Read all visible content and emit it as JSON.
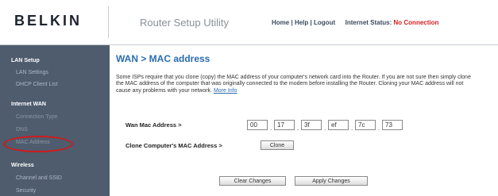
{
  "header": {
    "logo": "BELKIN",
    "title": "Router Setup Utility",
    "links": {
      "home": "Home",
      "sep1": "|",
      "help": "Help",
      "sep2": "|",
      "logout": "Logout"
    },
    "status_label": "Internet Status:",
    "status_value": "No Connection"
  },
  "sidebar": {
    "lan_setup": "LAN Setup",
    "lan_settings": "LAN Settings",
    "dhcp_client_list": "DHCP Client List",
    "internet_wan": "Internet WAN",
    "connection_type": "Connection Type",
    "dns": "DNS",
    "mac_address": "MAC Address",
    "wireless": "Wireless",
    "channel_ssid": "Channel and SSID",
    "security": "Security"
  },
  "main": {
    "title": "WAN > MAC address",
    "description": "Some ISPs require that you clone (copy) the MAC address of your computer's network card into the Router. If you are not sure then simply clone the MAC address of the computer that was originally connected to the modem before installing the Router. Cloning your MAC address will not cause any problems with your network.",
    "more_info": "More Info",
    "wan_mac_label": "Wan Mac Address >",
    "mac": [
      "00",
      "17",
      "3f",
      "ef",
      "7c",
      "73"
    ],
    "dot": ".",
    "clone_label": "Clone Computer's MAC Address >",
    "clone_button": "Clone",
    "clear_button": "Clear Changes",
    "apply_button": "Apply Changes"
  },
  "colors": {
    "accent": "#2a6db0",
    "sidebar": "#4e5c6e",
    "status_red": "#d42020",
    "highlight_circle": "#d11a1a"
  }
}
